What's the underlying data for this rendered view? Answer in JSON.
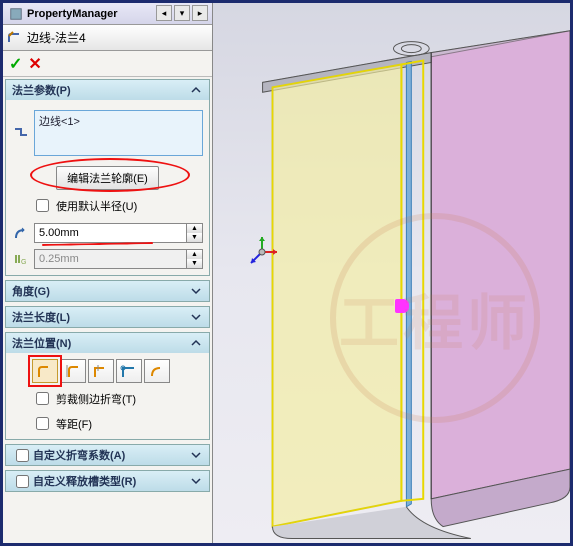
{
  "header": {
    "title": "PropertyManager"
  },
  "feature": {
    "name": "边线-法兰4"
  },
  "actions": {
    "ok": "✓",
    "cancel": "✕"
  },
  "sections": {
    "params": {
      "title": "法兰参数(P)",
      "selection_item": "边线<1>",
      "edit_profile_btn": "编辑法兰轮廓(E)",
      "use_default_radius": "使用默认半径(U)",
      "radius_value": "5.00mm",
      "gap_value": "0.25mm"
    },
    "angle": {
      "title": "角度(G)"
    },
    "length": {
      "title": "法兰长度(L)"
    },
    "position": {
      "title": "法兰位置(N)",
      "trim_side_bends": "剪裁侧边折弯(T)",
      "offset": "等距(F)"
    },
    "custom_bend": {
      "title": "自定义折弯系数(A)"
    },
    "custom_relief": {
      "title": "自定义释放槽类型(R)"
    }
  }
}
